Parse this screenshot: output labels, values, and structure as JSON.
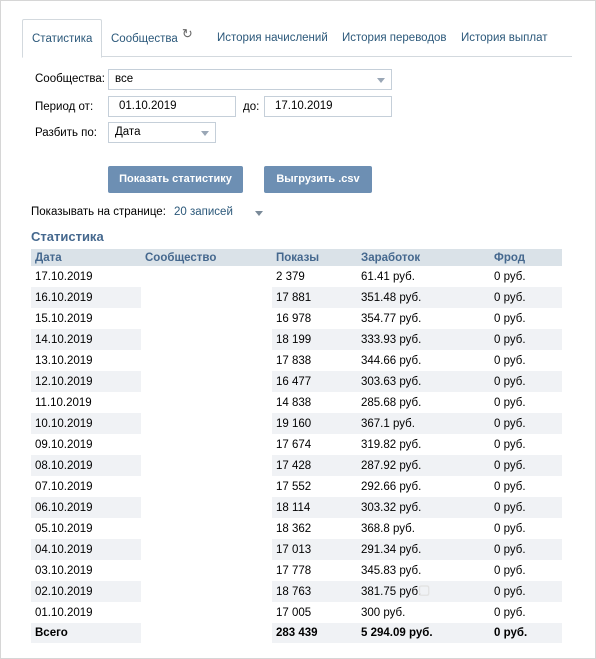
{
  "tabs": [
    {
      "label": "Статистика",
      "active": true
    },
    {
      "label": "Сообщества",
      "icon": "refresh-icon"
    },
    {
      "label": "История начислений"
    },
    {
      "label": "История переводов"
    },
    {
      "label": "История выплат"
    }
  ],
  "filters": {
    "communities_label": "Сообщества:",
    "communities_value": "все",
    "period_label": "Период от:",
    "period_from": "01.10.2019",
    "period_to_label": "до:",
    "period_to": "17.10.2019",
    "split_label": "Разбить по:",
    "split_value": "Дата"
  },
  "buttons": {
    "show_stats": "Показать статистику",
    "export_csv": "Выгрузить .csv"
  },
  "pagination": {
    "label": "Показывать на странице:",
    "value": "20 записей"
  },
  "section_title": "Статистика",
  "table": {
    "headers": [
      "Дата",
      "Сообщество",
      "Показы",
      "Заработок",
      "Фрод"
    ],
    "rows": [
      {
        "date": "17.10.2019",
        "community": "",
        "views": "2 379",
        "earnings": "61.41 руб.",
        "fraud": "0 руб."
      },
      {
        "date": "16.10.2019",
        "community": "",
        "views": "17 881",
        "earnings": "351.48 руб.",
        "fraud": "0 руб."
      },
      {
        "date": "15.10.2019",
        "community": "",
        "views": "16 978",
        "earnings": "354.77 руб.",
        "fraud": "0 руб."
      },
      {
        "date": "14.10.2019",
        "community": "",
        "views": "18 199",
        "earnings": "333.93 руб.",
        "fraud": "0 руб."
      },
      {
        "date": "13.10.2019",
        "community": "",
        "views": "17 838",
        "earnings": "344.66 руб.",
        "fraud": "0 руб."
      },
      {
        "date": "12.10.2019",
        "community": "",
        "views": "16 477",
        "earnings": "303.63 руб.",
        "fraud": "0 руб."
      },
      {
        "date": "11.10.2019",
        "community": "",
        "views": "14 838",
        "earnings": "285.68 руб.",
        "fraud": "0 руб."
      },
      {
        "date": "10.10.2019",
        "community": "",
        "views": "19 160",
        "earnings": "367.1 руб.",
        "fraud": "0 руб."
      },
      {
        "date": "09.10.2019",
        "community": "",
        "views": "17 674",
        "earnings": "319.82 руб.",
        "fraud": "0 руб."
      },
      {
        "date": "08.10.2019",
        "community": "",
        "views": "17 428",
        "earnings": "287.92 руб.",
        "fraud": "0 руб."
      },
      {
        "date": "07.10.2019",
        "community": "",
        "views": "17 552",
        "earnings": "292.66 руб.",
        "fraud": "0 руб."
      },
      {
        "date": "06.10.2019",
        "community": "",
        "views": "18 114",
        "earnings": "303.32 руб.",
        "fraud": "0 руб."
      },
      {
        "date": "05.10.2019",
        "community": "",
        "views": "18 362",
        "earnings": "368.8 руб.",
        "fraud": "0 руб."
      },
      {
        "date": "04.10.2019",
        "community": "",
        "views": "17 013",
        "earnings": "291.34 руб.",
        "fraud": "0 руб."
      },
      {
        "date": "03.10.2019",
        "community": "",
        "views": "17 778",
        "earnings": "345.83 руб.",
        "fraud": "0 руб."
      },
      {
        "date": "02.10.2019",
        "community": "",
        "views": "18 763",
        "earnings": "381.75 руб.",
        "fraud": "0 руб."
      },
      {
        "date": "01.10.2019",
        "community": "",
        "views": "17 005",
        "earnings": "300 руб.",
        "fraud": "0 руб."
      }
    ],
    "total": {
      "label": "Всего",
      "community": "",
      "views": "283 439",
      "earnings": "5 294.09 руб.",
      "fraud": "0 руб."
    }
  },
  "colors": {
    "link": "#2b587a",
    "button": "#6d8fb3",
    "header_bg": "#dae2e8",
    "title": "#45688e"
  }
}
